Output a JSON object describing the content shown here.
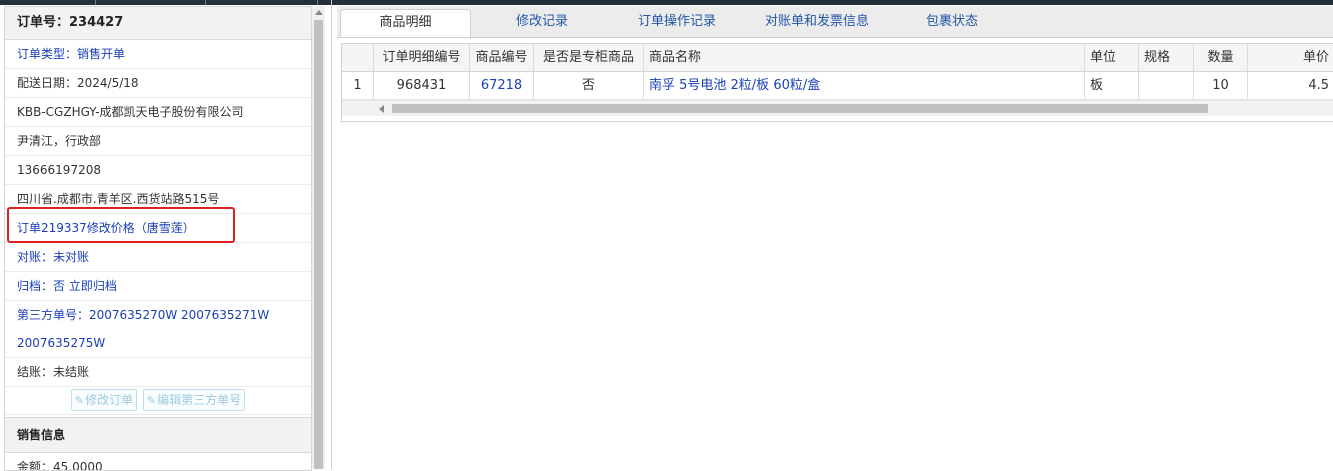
{
  "order": {
    "title": "订单号：234427",
    "type": "订单类型：销售开单",
    "delivery_date": "配送日期：2024/5/18",
    "customer": "KBB-CGZHGY-成都凯天电子股份有限公司",
    "contact": "尹清江，行政部",
    "phone": "13666197208",
    "address": "四川省.成都市.青羊区.西货站路515号",
    "price_change_note": "订单219337修改价格（唐雪莲）",
    "reconcile": "对账：未对账",
    "archive": "归档：否 立即归档",
    "third_party_no": "第三方单号：2007635270W 2007635271W 2007635275W",
    "settlement": "结账：未结账",
    "btn_modify_order": "修改订单",
    "btn_edit_third_party": "编辑第三方单号"
  },
  "sales": {
    "header": "销售信息",
    "amount": "金额：45.0000"
  },
  "tabs": [
    {
      "label": "商品明细",
      "active": true
    },
    {
      "label": "修改记录",
      "active": false
    },
    {
      "label": "订单操作记录",
      "active": false
    },
    {
      "label": "对账单和发票信息",
      "active": false
    },
    {
      "label": "包裹状态",
      "active": false
    }
  ],
  "grid": {
    "columns": [
      "",
      "订单明细编号",
      "商品编号",
      "是否是专柜商品",
      "商品名称",
      "单位",
      "规格",
      "数量",
      "单价"
    ],
    "rows": [
      {
        "index": "1",
        "detail_no": "968431",
        "product_no": "67218",
        "is_counter": "否",
        "name": "南孚 5号电池 2粒/板 60粒/盒",
        "unit": "板",
        "spec": "",
        "qty": "10",
        "price": "4.5"
      }
    ]
  },
  "colors": {
    "accent_blue": "#1a3fb8",
    "highlight_red": "#e02020",
    "topbar": "#26303d"
  },
  "icons": [
    "edit-icon"
  ]
}
